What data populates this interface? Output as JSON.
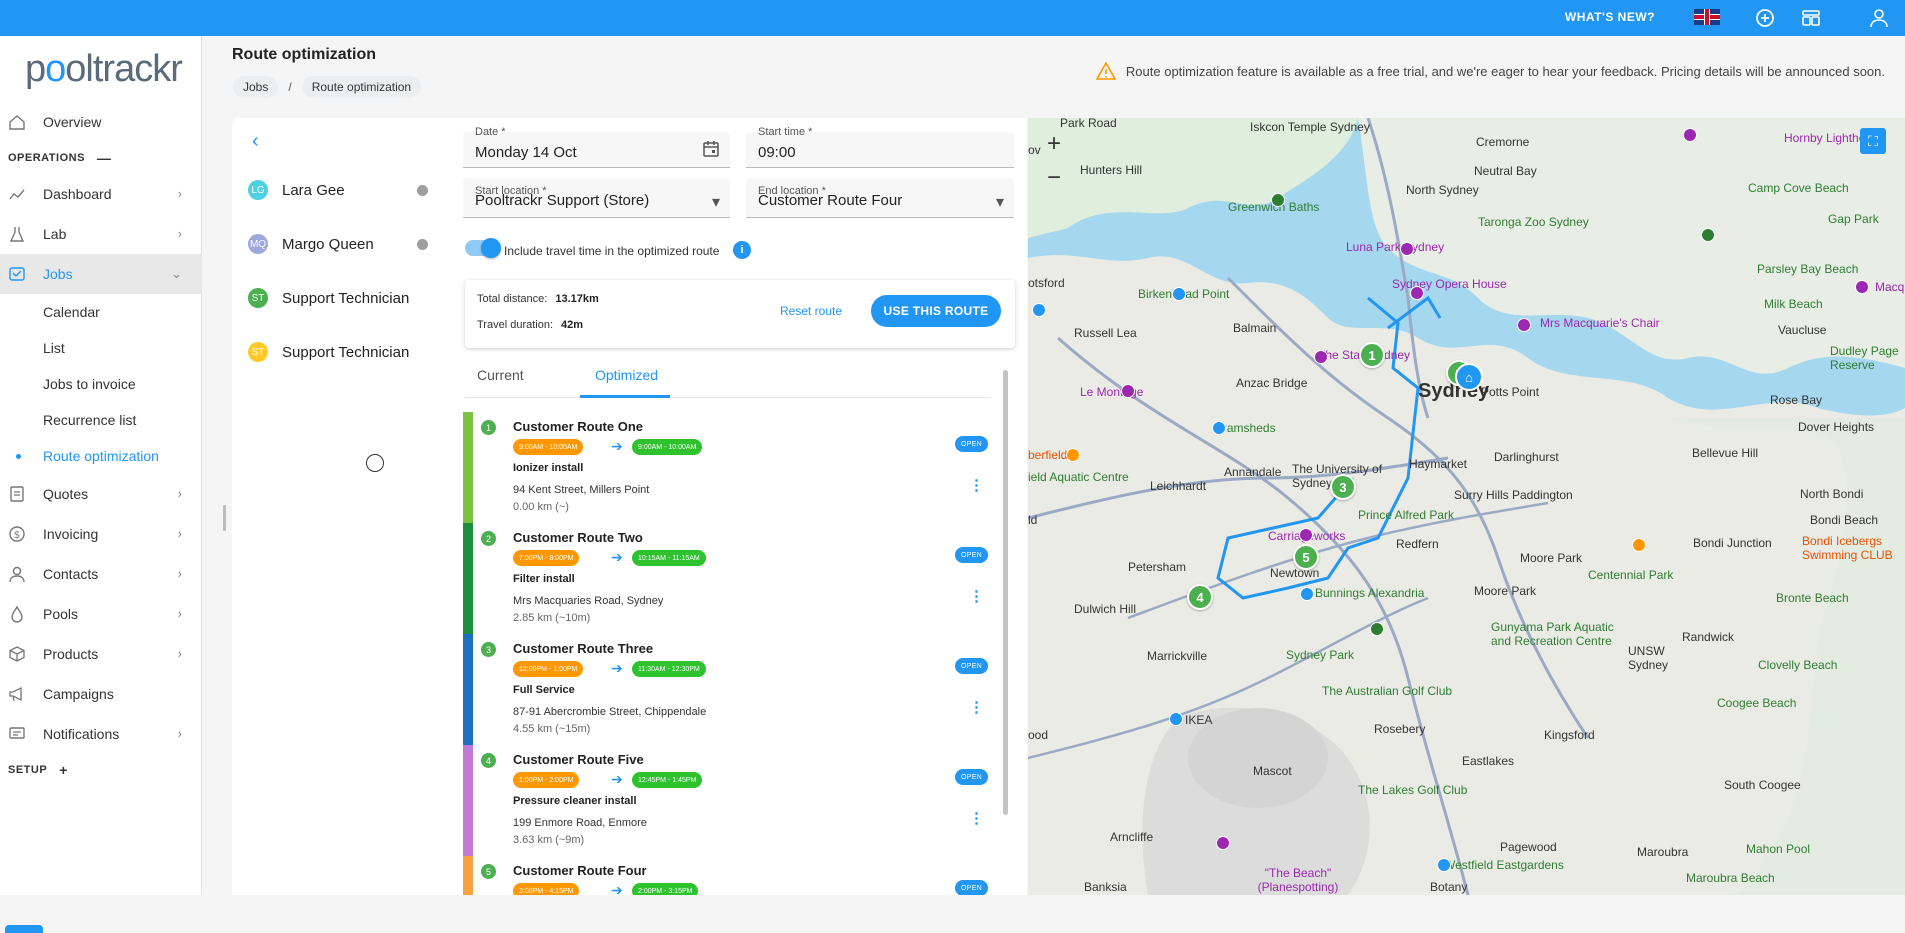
{
  "topbar": {
    "whats_new": "WHAT'S NEW?",
    "icons": [
      "uk-flag-icon",
      "add-circle-icon",
      "dashboard-icon",
      "user-icon"
    ]
  },
  "logo": {
    "text_a": "p",
    "text_b": "o",
    "text_c": "oltrackr"
  },
  "nav": {
    "overview": "Overview",
    "operations": "OPERATIONS",
    "operations_sign": "—",
    "dashboard": "Dashboard",
    "lab": "Lab",
    "jobs": "Jobs",
    "jobs_sub": [
      "Calendar",
      "List",
      "Jobs to invoice",
      "Recurrence list",
      "Route optimization"
    ],
    "quotes": "Quotes",
    "invoicing": "Invoicing",
    "contacts": "Contacts",
    "pools": "Pools",
    "products": "Products",
    "campaigns": "Campaigns",
    "notifications": "Notifications",
    "setup": "SETUP",
    "setup_sign": "+"
  },
  "header": {
    "title": "Route optimization",
    "breadcrumb": [
      "Jobs",
      "Route optimization"
    ],
    "breadcrumb_sep": "/",
    "notice": "Route optimization feature is available as a free trial, and we're eager to hear your feedback. Pricing details will be announced soon."
  },
  "technicians": [
    {
      "initials": "LG",
      "name": "Lara Gee",
      "color": "#4dd0e1"
    },
    {
      "initials": "MQ",
      "name": "Margo Queen",
      "color": "#9fa8da"
    },
    {
      "initials": "ST",
      "name": "Support Technician",
      "color": "#4caf50"
    },
    {
      "initials": "ST",
      "name": "Support Technician",
      "color": "#ffca28"
    }
  ],
  "form": {
    "date_label": "Date *",
    "date_value": "Monday 14 Oct",
    "start_time_label": "Start time *",
    "start_time_value": "09:00",
    "start_location_label": "Start location *",
    "start_location_value": "Pooltrackr Support (Store)",
    "end_location_label": "End location *",
    "end_location_value": "Customer Route Four",
    "toggle_label": "Include travel time in the optimized route",
    "toggle_on": true
  },
  "summary": {
    "distance_label": "Total distance:",
    "distance_value": "13.17km",
    "duration_label": "Travel duration:",
    "duration_value": "42m",
    "reset": "Reset route",
    "use": "USE THIS ROUTE"
  },
  "tabs": {
    "current": "Current",
    "optimized": "Optimized"
  },
  "stops": [
    {
      "num": "1",
      "name": "Customer Route One",
      "orig": "9:00AM - 10:00AM",
      "opt": "9:00AM - 10:00AM",
      "job": "Ionizer install",
      "addr": "94 Kent Street, Millers Point",
      "dist": "0.00 km (~)",
      "status": "OPEN",
      "color": "#7cc142"
    },
    {
      "num": "2",
      "name": "Customer Route Two",
      "orig": "7:00PM - 8:00PM",
      "opt": "10:15AM - 11:15AM",
      "job": "Filter install",
      "addr": "Mrs Macquaries Road, Sydney",
      "dist": "2.85 km (~10m)",
      "status": "OPEN",
      "color": "#1e8e3e"
    },
    {
      "num": "3",
      "name": "Customer Route Three",
      "orig": "12:00PM - 1:00PM",
      "opt": "11:30AM - 12:30PM",
      "job": "Full Service",
      "addr": "87-91 Abercrombie Street, Chippendale",
      "dist": "4.55 km (~15m)",
      "status": "OPEN",
      "color": "#1f6fbf"
    },
    {
      "num": "4",
      "name": "Customer Route Five",
      "orig": "1:00PM - 2:00PM",
      "opt": "12:45PM - 1:45PM",
      "job": "Pressure cleaner install",
      "addr": "199 Enmore Road, Enmore",
      "dist": "3.63 km (~9m)",
      "status": "OPEN",
      "color": "#c27ad6"
    },
    {
      "num": "5",
      "name": "Customer Route Four",
      "orig": "3:00PM - 4:15PM",
      "opt": "2:00PM - 3:15PM",
      "job": "",
      "addr": "",
      "dist": "",
      "status": "OPEN",
      "color": "#f4a340"
    }
  ],
  "map": {
    "zoom_in": "+",
    "zoom_out": "−",
    "labels": {
      "park_road": "Park Road",
      "iskcon": "Iskcon Temple Sydney",
      "cremorne": "Cremorne",
      "hornby": "Hornby Lighthouse",
      "hunters": "Hunters Hill",
      "neutral": "Neutral Bay",
      "north_sydney": "North Sydney",
      "camp_cove": "Camp Cove Beach",
      "greenwich": "Greenwich Baths",
      "taronga": "Taronga Zoo Sydney",
      "gap_park": "Gap Park",
      "luna": "Luna Park Sydney",
      "parsley": "Parsley Bay Beach",
      "macq": "Macq",
      "otsford": "otsford",
      "birkenhead": "Birkenhead Point",
      "opera": "Sydney Opera House",
      "milk": "Milk Beach",
      "russell": "Russell Lea",
      "balmain": "Balmain",
      "mrs_macq": "Mrs Macquarie's Chair",
      "vaucluse": "Vaucluse",
      "dudley": "Dudley Page Reserve",
      "star": "The Star, Sydney",
      "sydney": "Sydney",
      "potts": "Potts Point",
      "rose_bay": "Rose Bay",
      "le_montage": "Le Montage",
      "anzac": "Anzac Bridge",
      "dover": "Dover Heights",
      "tramsheds": "Tramsheds",
      "darlinghurst": "Darlinghurst",
      "bellevue": "Bellevue Hill",
      "annandale": "Annandale",
      "uni": "The University of Sydney",
      "haymarket": "Haymarket",
      "berfield": "berfield",
      "aquatic": "ield Aquatic Centre",
      "leichhardt": "Leichhardt",
      "surry": "Surry Hills Paddington",
      "north_bondi": "North Bondi",
      "prince_alfred": "Prince Alfred Park",
      "bondi_beach": "Bondi Beach",
      "carriageworks": "Carriageworks",
      "redfern": "Redfern",
      "bondi_junction": "Bondi Junction",
      "bondi_icebergs": "Bondi Icebergs Swimming CLUB",
      "moore_park": "Moore Park",
      "centennial": "Centennial Park",
      "petersham": "Petersham",
      "newtown": "Newtown",
      "moore_park2": "Moore Park",
      "bunnings": "Bunnings Alexandria",
      "bronte": "Bronte Beach",
      "dulwich": "Dulwich Hill",
      "gunyama": "Gunyama Park Aquatic and Recreation Centre",
      "unsw": "UNSW Sydney",
      "randwick": "Randwick",
      "clovelly": "Clovelly Beach",
      "marrickville": "Marrickville",
      "sydney_park": "Sydney Park",
      "golf": "The Australian Golf Club",
      "coogee": "Coogee Beach",
      "ikea": "IKEA",
      "rosebery": "Rosebery",
      "kingsford": "Kingsford",
      "ood": "ood",
      "mascot": "Mascot",
      "eastlakes": "Eastlakes",
      "lakes_golf": "The Lakes Golf Club",
      "south_coogee": "South Coogee",
      "arncliffe": "Arncliffe",
      "pagewood": "Pagewood",
      "maroubra": "Maroubra",
      "mahon": "Mahon Pool",
      "westfield": "Westfield Eastgardens",
      "the_beach": "\"The Beach\" (Planespotting)",
      "banksia": "Banksia",
      "botany": "Botany",
      "maroubra_beach": "Maroubra Beach",
      "ld": "ld",
      "ov": "ov"
    },
    "markers": [
      "1",
      "2",
      "3",
      "4",
      "5"
    ]
  }
}
